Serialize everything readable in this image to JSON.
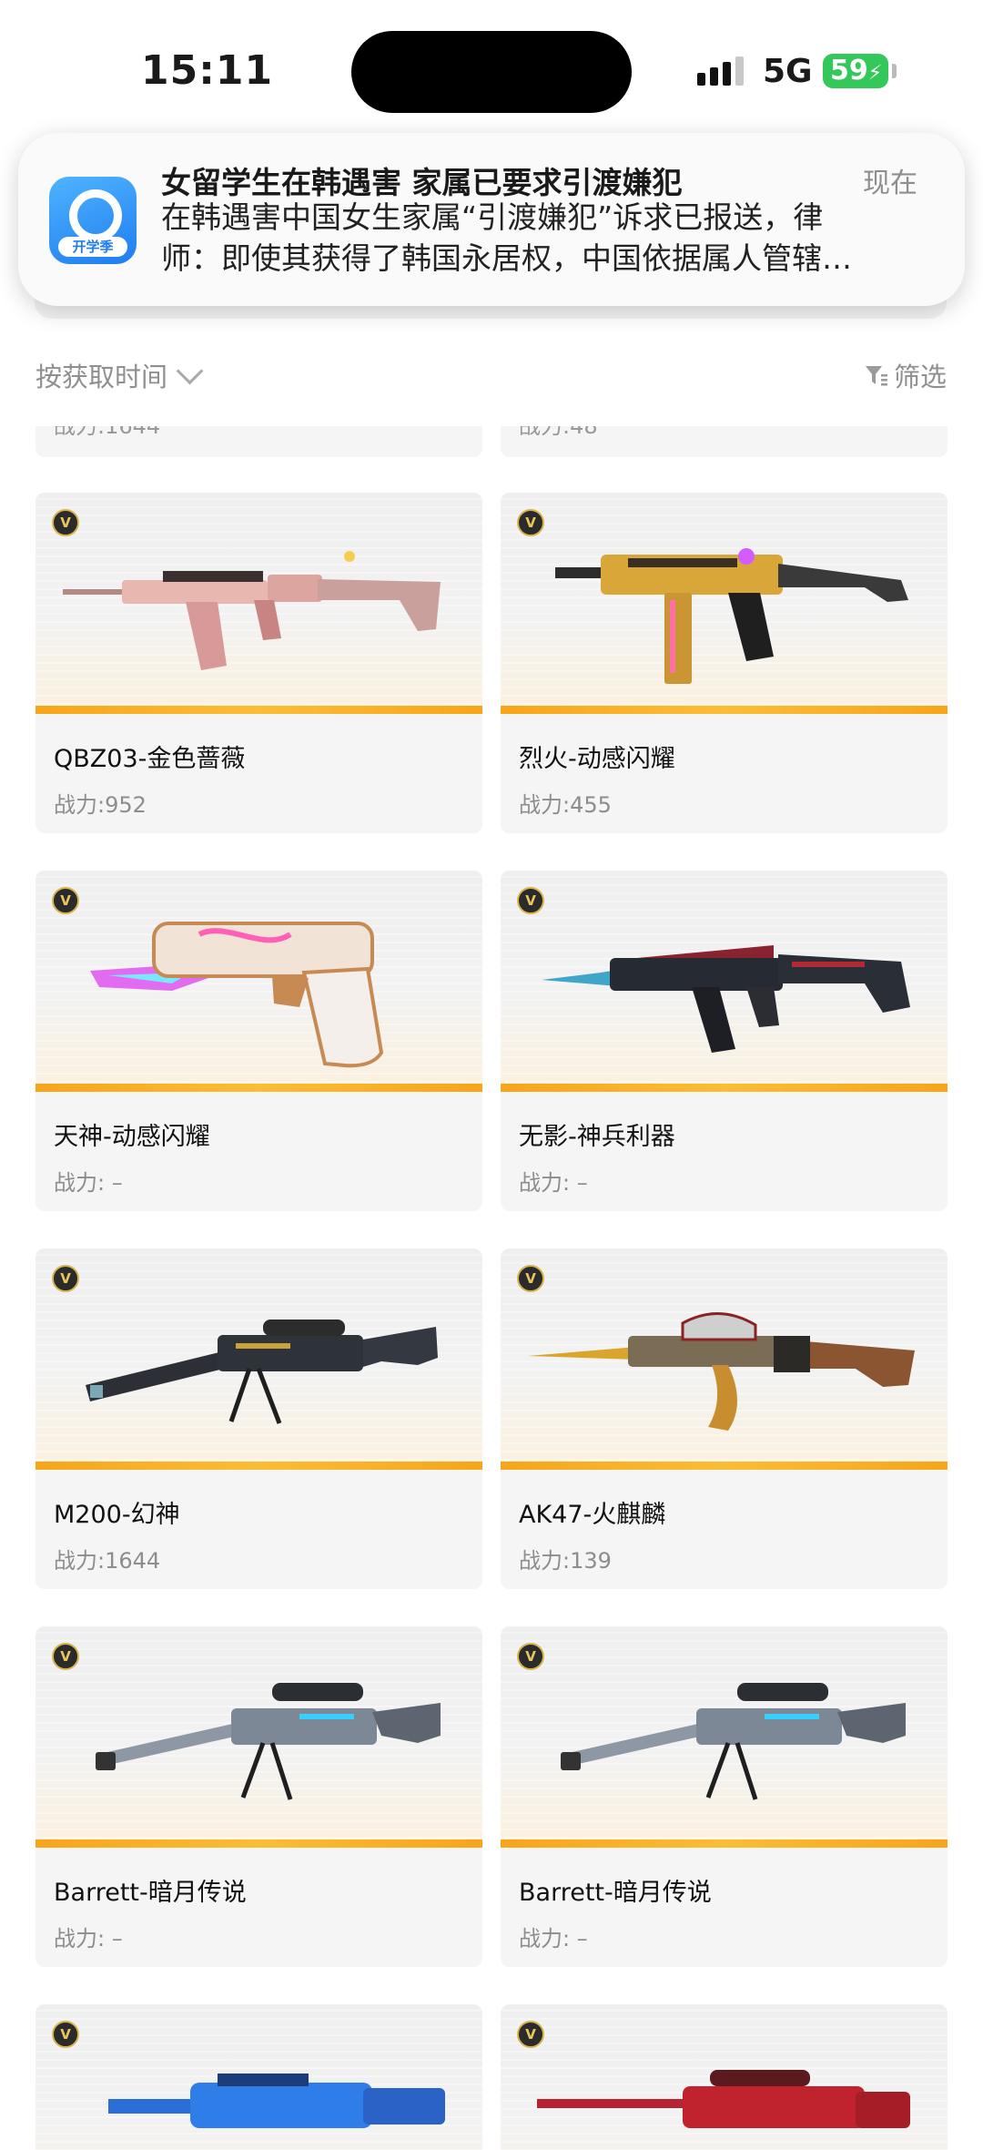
{
  "status_bar": {
    "time": "15:11",
    "network": "5G",
    "battery": "59"
  },
  "notification": {
    "title": "女留学生在韩遇害 家属已要求引渡嫌犯",
    "time": "现在",
    "body_line1": "在韩遇害中国女生家属“引渡嫌犯”诉求已报送，律",
    "body_line2": "师：即使其获得了韩国永居权，中国依据属人管辖…",
    "app_icon_label": "开学季"
  },
  "filter_bar": {
    "sort_label": "按获取时间",
    "filter_label": "筛选"
  },
  "colors": {
    "accent_bar": "#f7a51a",
    "card_bg": "#f5f5f5",
    "muted_text": "#8d8d8d"
  },
  "items": [
    {
      "name": "QBZ03-金色蔷薇",
      "power": "战力:952",
      "badge": "V",
      "icon": "rifle-pink-icon"
    },
    {
      "name": "烈火-动感闪耀",
      "power": "战力:455",
      "badge": "V",
      "icon": "smg-gold-icon"
    },
    {
      "name": "天神-动感闪耀",
      "power": "战力: –",
      "badge": "V",
      "icon": "pistol-white-icon"
    },
    {
      "name": "无影-神兵利器",
      "power": "战力: –",
      "badge": "V",
      "icon": "rifle-dark-icon"
    },
    {
      "name": "M200-幻神",
      "power": "战力:1644",
      "badge": "V",
      "icon": "sniper-black-icon"
    },
    {
      "name": "AK47-火麒麟",
      "power": "战力:139",
      "badge": "V",
      "icon": "ak47-gold-icon"
    },
    {
      "name": "Barrett-暗月传说",
      "power": "战力: –",
      "badge": "V",
      "icon": "sniper-silver-icon"
    },
    {
      "name": "Barrett-暗月传说",
      "power": "战力: –",
      "badge": "V",
      "icon": "sniper-silver-icon"
    },
    {
      "name": "",
      "power": "",
      "badge": "V",
      "icon": "rifle-blue-icon"
    },
    {
      "name": "",
      "power": "",
      "badge": "V",
      "icon": "sniper-red-icon"
    }
  ]
}
